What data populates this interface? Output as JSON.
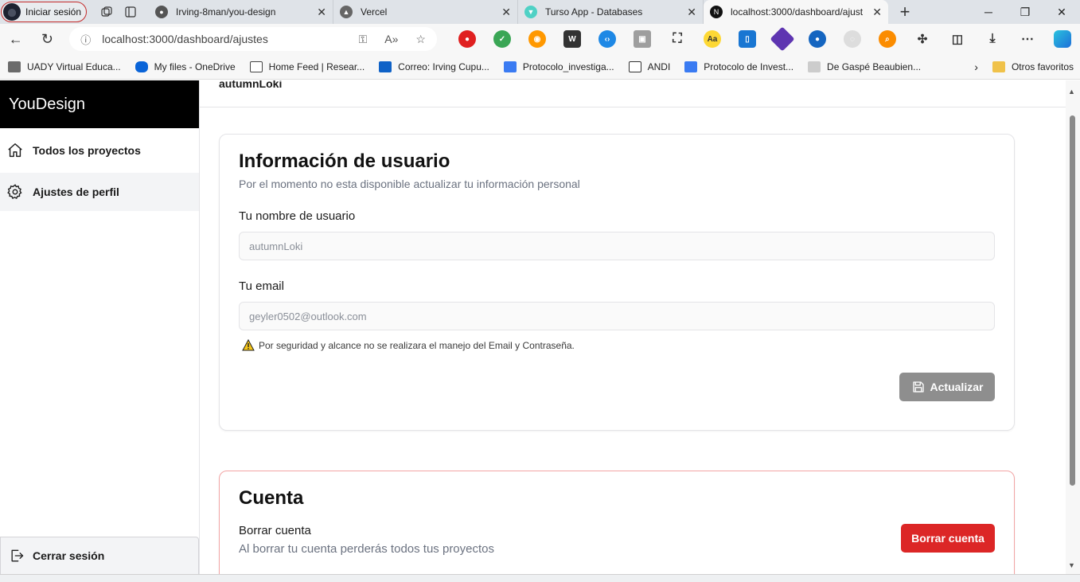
{
  "browser": {
    "profile_label": "Iniciar sesión",
    "tabs": [
      {
        "title": "Irving-8man/you-design",
        "icon": "github-icon",
        "active": false
      },
      {
        "title": "Vercel",
        "icon": "vercel-icon",
        "active": false
      },
      {
        "title": "Turso App - Databases",
        "icon": "turso-icon",
        "active": false
      },
      {
        "title": "localhost:3000/dashboard/ajust",
        "icon": "nextjs-icon",
        "active": true
      }
    ],
    "url": "localhost:3000/dashboard/ajustes",
    "bookmarks": [
      {
        "label": "UADY Virtual Educa...",
        "color": "#6b6b6b"
      },
      {
        "label": "My files - OneDrive",
        "color": "#0a64d8"
      },
      {
        "label": "Home Feed | Resear...",
        "color": "#444444"
      },
      {
        "label": "Correo: Irving Cupu...",
        "color": "#0f62c7"
      },
      {
        "label": "Protocolo_investiga...",
        "color": "#3a7bf2"
      },
      {
        "label": "ANDI",
        "color": "#ffffff"
      },
      {
        "label": "Protocolo de Invest...",
        "color": "#3a7bf2"
      },
      {
        "label": "De Gaspé Beaubien...",
        "color": "#888888"
      }
    ],
    "other_favorites": "Otros favoritos"
  },
  "sidebar": {
    "brand": "YouDesign",
    "items": [
      {
        "label": "Todos los proyectos",
        "icon": "home-icon"
      },
      {
        "label": "Ajustes de perfil",
        "icon": "gear-icon"
      }
    ],
    "logout": "Cerrar sesión"
  },
  "main": {
    "top_username": "autumnLoki",
    "info_card": {
      "title": "Información de usuario",
      "subtitle": "Por el momento no esta disponible actualizar tu información personal",
      "username_label": "Tu nombre de usuario",
      "username_placeholder": "autumnLoki",
      "email_label": "Tu email",
      "email_placeholder": "geyler0502@outlook.com",
      "warning": "Por seguridad y alcance no se realizara el manejo del Email y Contraseña.",
      "update_button": "Actualizar"
    },
    "account_card": {
      "title": "Cuenta",
      "delete_title": "Borrar cuenta",
      "delete_desc": "Al borrar tu cuenta perderás todos tus proyectos",
      "delete_button": "Borrar cuenta"
    }
  },
  "colors": {
    "danger": "#dc2626",
    "disabled_button": "#8e8e8e",
    "brand_bg": "#000000"
  }
}
